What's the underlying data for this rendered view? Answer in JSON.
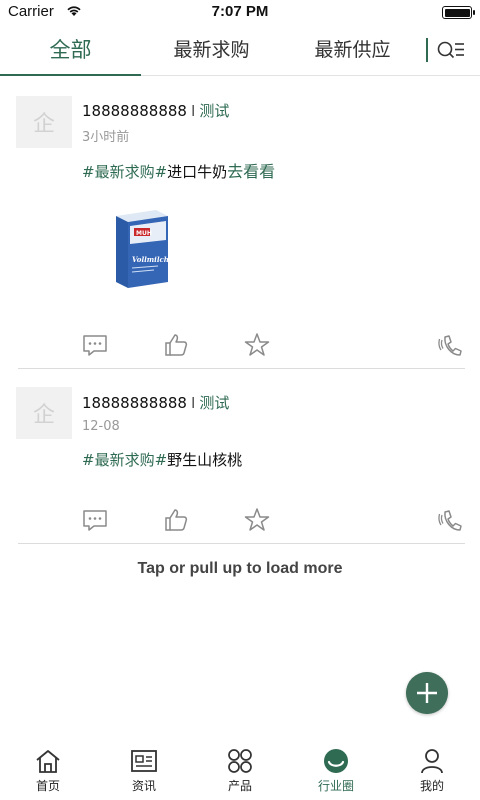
{
  "status_bar": {
    "carrier": "Carrier",
    "time": "7:07 PM"
  },
  "tabs": [
    {
      "label": "全部",
      "active": true
    },
    {
      "label": "最新求购",
      "active": false
    },
    {
      "label": "最新供应",
      "active": false
    }
  ],
  "posts": [
    {
      "avatar_char": "企",
      "phone": "18888888888",
      "separator": "I",
      "tag": "测试",
      "time": "3小时前",
      "hashtag": "#最新求购#",
      "text": "进口牛奶",
      "more": "去看看",
      "image": {
        "brand": "MUH",
        "product": "Vollmilch"
      }
    },
    {
      "avatar_char": "企",
      "phone": "18888888888",
      "separator": "I",
      "tag": "测试",
      "time": "12-08",
      "hashtag": "#最新求购#",
      "text": "野生山核桃"
    }
  ],
  "load_more": "Tap or pull up to load more",
  "bottom_nav": [
    {
      "label": "首页",
      "icon": "home-icon",
      "active": false
    },
    {
      "label": "资讯",
      "icon": "news-icon",
      "active": false
    },
    {
      "label": "产品",
      "icon": "products-icon",
      "active": false
    },
    {
      "label": "行业圈",
      "icon": "industry-circle-icon",
      "active": true
    },
    {
      "label": "我的",
      "icon": "profile-icon",
      "active": false
    }
  ],
  "colors": {
    "accent": "#2f6b53",
    "fab": "#3f6e5a",
    "divider": "#dcdcdc"
  }
}
